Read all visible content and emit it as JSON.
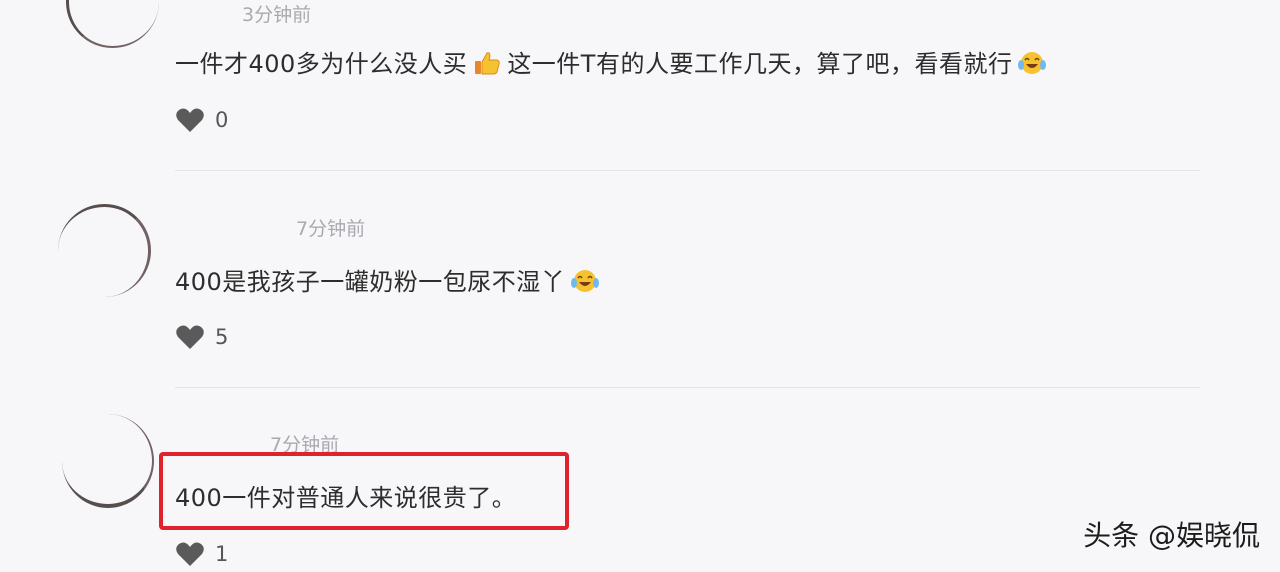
{
  "comments": [
    {
      "timestamp": "3分钟前",
      "text_parts": [
        "一件才400多为什么没人买",
        "这一件T有的人要工作几天，算了吧，看看就行"
      ],
      "likes": "0"
    },
    {
      "timestamp": "7分钟前",
      "text_parts": [
        "400是我孩子一罐奶粉一包尿不湿丫"
      ],
      "likes": "5"
    },
    {
      "timestamp": "7分钟前",
      "text_parts": [
        "400一件对普通人来说很贵了。"
      ],
      "likes": "1"
    }
  ],
  "icons": {
    "like": "heart-icon",
    "thumbs_up": "thumbs-up-emoji",
    "laugh_cry": "laughing-crying-emoji"
  },
  "colors": {
    "highlight_border": "#e0232b",
    "heart": "#5a5a5a",
    "emoji_yellow": "#f6c230"
  },
  "watermark": "头条 @娱晓侃"
}
